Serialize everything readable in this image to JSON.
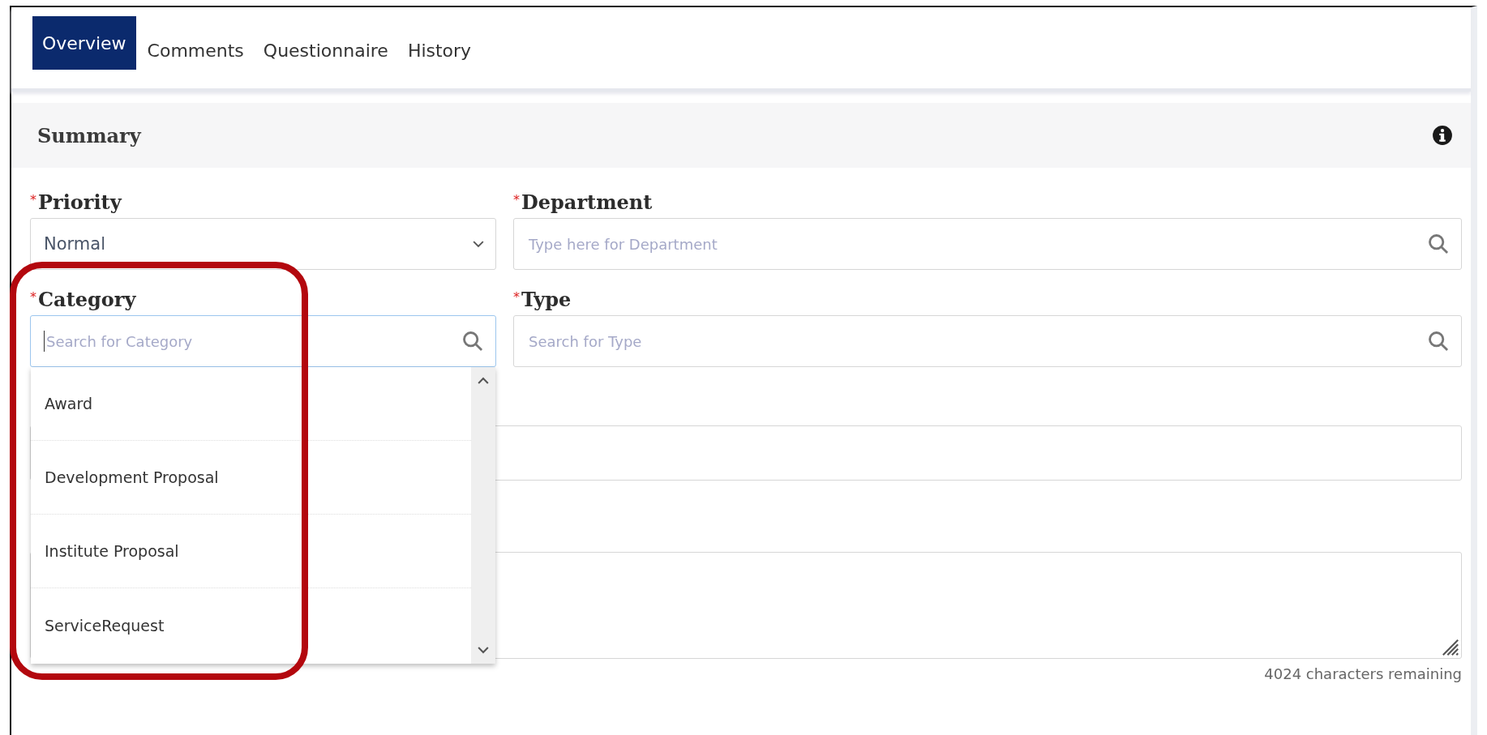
{
  "tabs": [
    {
      "label": "Overview",
      "selected": true
    },
    {
      "label": "Comments",
      "selected": false
    },
    {
      "label": "Questionnaire",
      "selected": false
    },
    {
      "label": "History",
      "selected": false
    }
  ],
  "summary": {
    "title": "Summary"
  },
  "fields": [
    {
      "kind": "select",
      "label": "Priority",
      "required_marker": "*",
      "value": "Normal",
      "focused": false,
      "highlighted": false
    },
    {
      "kind": "search",
      "label": "Department",
      "required_marker": "*",
      "placeholder": "Type here for Department",
      "focused": false,
      "highlighted": false
    },
    {
      "kind": "search",
      "label": "Category",
      "required_marker": "*",
      "placeholder": "Search for Category",
      "focused": true,
      "highlighted": true
    },
    {
      "kind": "search",
      "label": "Type",
      "required_marker": "*",
      "placeholder": "Search for Type",
      "focused": false,
      "highlighted": false
    }
  ],
  "category_dropdown": {
    "options": [
      "Award",
      "Development Proposal",
      "Institute Proposal",
      "ServiceRequest"
    ]
  },
  "blank_fields": [
    {
      "kind": "input"
    },
    {
      "kind": "textarea"
    }
  ],
  "counter": "4024 characters remaining"
}
